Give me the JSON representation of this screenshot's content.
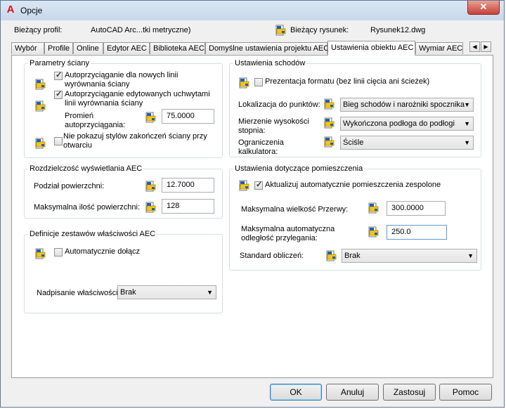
{
  "window": {
    "title": "Opcje",
    "close_label": "✕"
  },
  "header": {
    "profile_label": "Bieżący profil:",
    "profile_value": "AutoCAD Arc...tki metryczne)",
    "drawing_label": "Bieżący rysunek:",
    "drawing_value": "Rysunek12.dwg"
  },
  "tabs": [
    "Wybór",
    "Profile",
    "Online",
    "Edytor AEC",
    "Biblioteka AEC",
    "Domyślne ustawienia projektu AEC",
    "Ustawienia obiektu AEC",
    "Wymiar AEC"
  ],
  "tab_scroll": {
    "left": "◀",
    "right": "▶"
  },
  "wall": {
    "title": "Parametry ściany",
    "autosnap_new": [
      "Autoprzyciąganie dla nowych linii",
      "wyrównania ściany"
    ],
    "autosnap_new_checked": true,
    "autosnap_edit": [
      "Autoprzyciąganie edytowanych uchwytami",
      "linii wyrównania ściany"
    ],
    "autosnap_edit_checked": true,
    "radius_label": [
      "Promień",
      "autoprzyciągania:"
    ],
    "radius_value": "75.0000",
    "noshow": [
      "Nie pokazuj stylów zakończeń ściany przy",
      "otwarciu"
    ],
    "noshow_checked": false
  },
  "resolution": {
    "title": "Rozdzielczość wyświetlania AEC",
    "facet_label": "Podział powierzchni:",
    "facet_value": "12.7000",
    "max_label": "Maksymalna ilość powierzchni:",
    "max_value": "128"
  },
  "propsets": {
    "title": "Definicje zestawów właściwości AEC",
    "auto_label": "Automatycznie dołącz",
    "auto_checked": false,
    "override_label": "Nadpisanie właściwości",
    "override_value": "Brak"
  },
  "stairs": {
    "title": "Ustawienia schodów",
    "present_label": "Prezentacja formatu (bez linii cięcia ani ścieżek)",
    "present_checked": false,
    "locate_label": "Lokalizacja do punktów:",
    "locate_value": "Bieg schodów i narożniki spocznika",
    "measure_label": [
      "Mierzenie wysokości",
      "stopnia:"
    ],
    "measure_value": "Wykończona podłoga do podłogi",
    "limit_label": [
      "Ograniczenia",
      "kalkulatora:"
    ],
    "limit_value": "Ściśle"
  },
  "space": {
    "title": "Ustawienia dotyczące pomieszczenia",
    "update_label": "Aktualizuj automatycznie pomieszczenia zespolone",
    "update_checked": true,
    "gap_label": "Maksymalna wielkość Przerwy:",
    "gap_value": "300.0000",
    "adj_label": [
      "Maksymalna automatyczna",
      "odległość przylegania:"
    ],
    "adj_value": "250.0",
    "std_label": "Standard obliczeń:",
    "std_value": "Brak"
  },
  "buttons": {
    "ok": "OK",
    "cancel": "Anuluj",
    "apply": "Zastosuj",
    "help": "Pomoc"
  },
  "colors": {
    "accent": "#3c7fb1",
    "app_icon": "#d6121c",
    "icon_yellow": "#f5c518",
    "icon_blue": "#1d5fb5"
  }
}
